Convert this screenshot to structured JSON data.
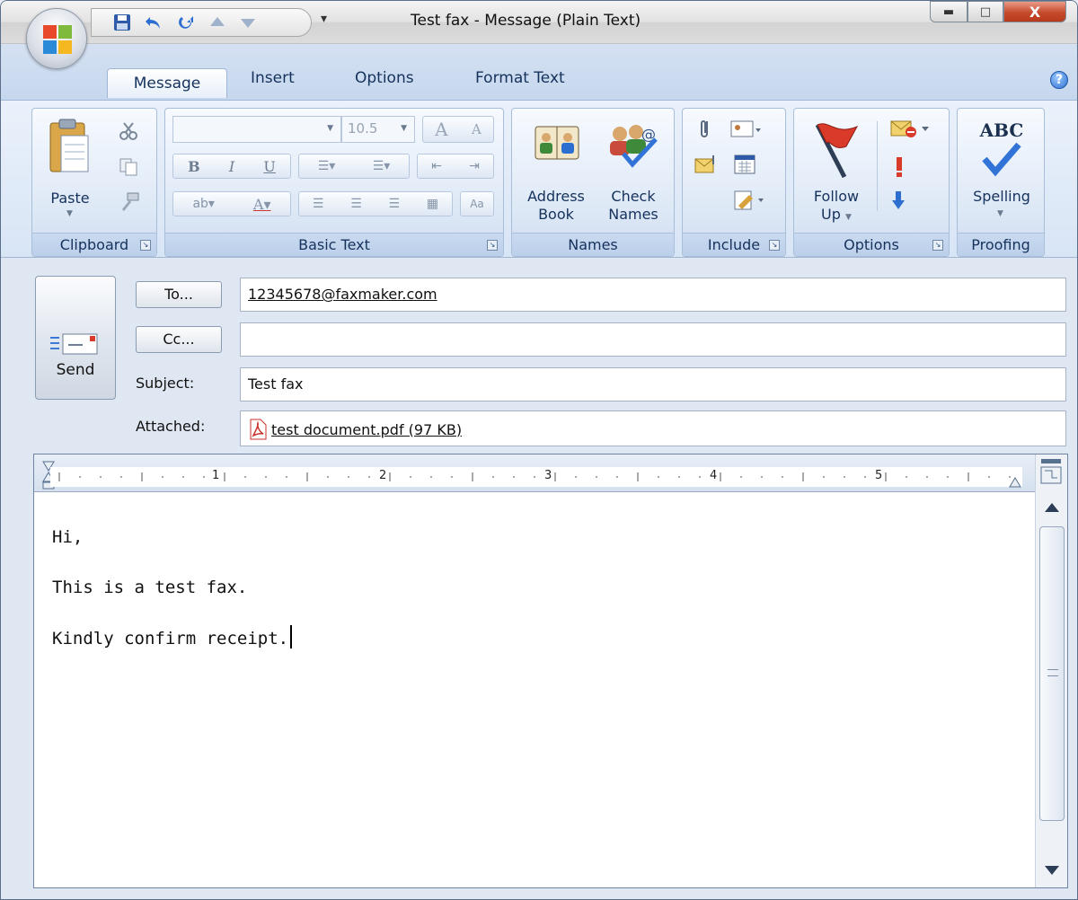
{
  "window": {
    "title": "Test fax - Message (Plain Text)"
  },
  "tabs": [
    "Message",
    "Insert",
    "Options",
    "Format Text"
  ],
  "ribbon": {
    "clipboard": {
      "paste_label": "Paste",
      "group_label": "Clipboard"
    },
    "basic_text": {
      "font_size": "10.5",
      "group_label": "Basic Text",
      "bold": "B",
      "italic": "I",
      "underline": "U",
      "grow_font": "A",
      "shrink_font": "A"
    },
    "names": {
      "address_book_line1": "Address",
      "address_book_line2": "Book",
      "check_names_line1": "Check",
      "check_names_line2": "Names",
      "group_label": "Names"
    },
    "include": {
      "group_label": "Include"
    },
    "options": {
      "follow_up_line1": "Follow",
      "follow_up_line2": "Up",
      "group_label": "Options"
    },
    "proofing": {
      "spelling_icon_text": "ABC",
      "spelling_label": "Spelling",
      "group_label": "Proofing"
    }
  },
  "header": {
    "send_label": "Send",
    "to_label": "To...",
    "to_value": "12345678@faxmaker.com",
    "cc_label": "Cc...",
    "cc_value": "",
    "subject_label": "Subject:",
    "subject_value": "Test fax",
    "attached_label": "Attached:",
    "attachment": "test document.pdf (97 KB)"
  },
  "ruler": {
    "numbers": [
      "1",
      "2",
      "3",
      "4",
      "5"
    ]
  },
  "body": {
    "line1": "Hi,",
    "line2": "This is a test fax.",
    "line3": "Kindly confirm receipt."
  },
  "colors": {
    "ribbon_bg": "#d8e5f5",
    "accent_blue": "#15325c",
    "close_red": "#c64a2c"
  }
}
